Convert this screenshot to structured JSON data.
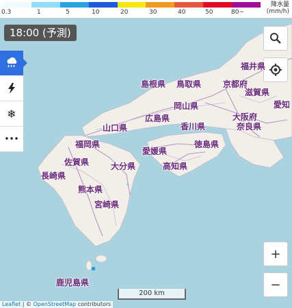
{
  "legend": {
    "ticks": [
      "0.3",
      "1",
      "5",
      "10",
      "20",
      "30",
      "40",
      "50",
      "80~"
    ],
    "colors": [
      "#f0fbff",
      "#8fe0ff",
      "#29a0e0",
      "#1c5ad9",
      "#f5e90b",
      "#f39a1f",
      "#e55a3d",
      "#e30b25",
      "#a10b9b"
    ],
    "unit_line1": "降水量",
    "unit_line2": "(mm/h)"
  },
  "time_label": "18:00 (予測)",
  "sidebar": {
    "rain_icon": "cloud-rain-icon",
    "lightning_icon": "lightning-icon",
    "snow_icon": "snowflake-icon",
    "more_label": "•••"
  },
  "controls": {
    "zoom_in": "+",
    "zoom_out": "−"
  },
  "scale_label": "200 km",
  "attribution": {
    "leaflet": "Leaflet",
    "osm": "OpenStreetMap",
    "rest": "contributors"
  },
  "prefectures": [
    {
      "name": "島根県"
    },
    {
      "name": "鳥取県"
    },
    {
      "name": "京都府"
    },
    {
      "name": "福井県"
    },
    {
      "name": "滋賀県"
    },
    {
      "name": "岡山県"
    },
    {
      "name": "愛知"
    },
    {
      "name": "広島県"
    },
    {
      "name": "大阪府"
    },
    {
      "name": "山口県"
    },
    {
      "name": "香川県"
    },
    {
      "name": "奈良県"
    },
    {
      "name": "福岡県"
    },
    {
      "name": "徳島県"
    },
    {
      "name": "愛媛県"
    },
    {
      "name": "佐賀県"
    },
    {
      "name": "大分県"
    },
    {
      "name": "高知県"
    },
    {
      "name": "長崎県"
    },
    {
      "name": "熊本県"
    },
    {
      "name": "宮崎県"
    },
    {
      "name": "鹿児島県"
    }
  ]
}
